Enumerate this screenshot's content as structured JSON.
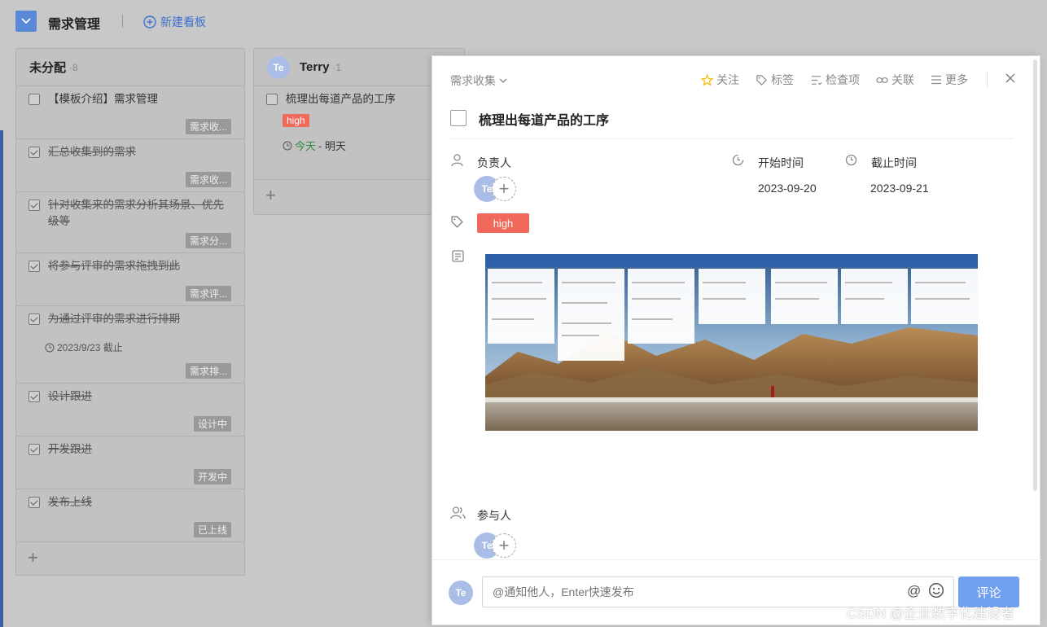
{
  "topbar": {
    "board_title": "需求管理",
    "new_board_label": "新建看板"
  },
  "columns": [
    {
      "name": "未分配",
      "count": "·8",
      "cards": [
        {
          "title": "【模板介绍】需求管理",
          "checked": false,
          "tag": "需求收..."
        },
        {
          "title": "汇总收集到的需求",
          "checked": true,
          "tag": "需求收..."
        },
        {
          "title": "针对收集来的需求分析其场景、优先级等",
          "checked": true,
          "tag": "需求分..."
        },
        {
          "title": "将参与评审的需求拖拽到此",
          "checked": true,
          "tag": "需求评..."
        },
        {
          "title": "为通过评审的需求进行排期",
          "checked": true,
          "due": "2023/9/23 截止",
          "tag": "需求排..."
        },
        {
          "title": "设计跟进",
          "checked": true,
          "tag": "设计中"
        },
        {
          "title": "开发跟进",
          "checked": true,
          "tag": "开发中"
        },
        {
          "title": "发布上线",
          "checked": true,
          "tag": "已上线"
        }
      ]
    },
    {
      "name": "Terry",
      "count": "·1",
      "avatar": "Te",
      "cards": [
        {
          "title": "梳理出每道产品的工序",
          "checked": false,
          "priority": "high",
          "date_today": "今天",
          "date_rest": " - 明天"
        }
      ]
    }
  ],
  "panel": {
    "category": "需求收集",
    "actions": {
      "follow": "关注",
      "tags": "标签",
      "checklist": "检查项",
      "link": "关联",
      "more": "更多"
    },
    "title": "梳理出每道产品的工序",
    "assignee_label": "负责人",
    "assignee_avatar": "Te",
    "start_label": "开始时间",
    "start_date": "2023-09-20",
    "due_label": "截止时间",
    "due_date": "2023-09-21",
    "priority_tag": "high",
    "participants_label": "参与人",
    "participant_avatar": "Te",
    "comment_placeholder": "@通知他人，Enter快速发布",
    "comment_button": "评论",
    "commenter_avatar": "Te"
  },
  "watermark": "CSDN @企业数字化建设者",
  "colors": {
    "accent": "#3f6fcf",
    "high": "#f0695a",
    "comment_button": "#72a0f0",
    "follow_star": "#f5b800"
  }
}
